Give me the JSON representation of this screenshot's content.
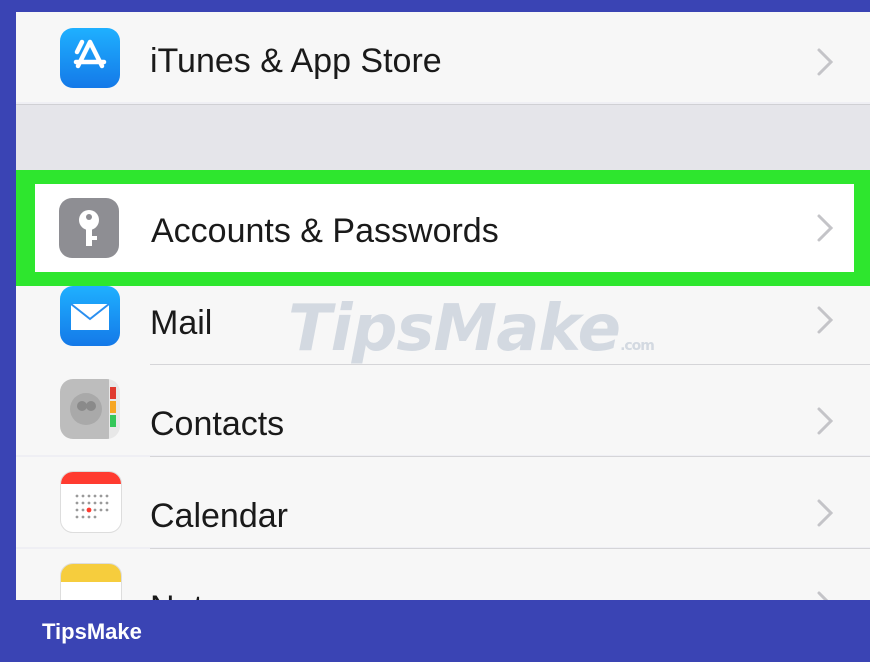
{
  "settings": {
    "rows": [
      {
        "label": "iTunes & App Store",
        "icon": "app-store-icon"
      },
      {
        "label": "Accounts & Passwords",
        "icon": "key-icon"
      },
      {
        "label": "Mail",
        "icon": "mail-icon"
      },
      {
        "label": "Contacts",
        "icon": "contacts-icon"
      },
      {
        "label": "Calendar",
        "icon": "calendar-icon"
      },
      {
        "label": "Notes",
        "icon": "notes-icon"
      }
    ]
  },
  "watermark": {
    "main": "TipsMake",
    "suffix": ".com"
  },
  "footer": {
    "brand": "TipsMake"
  },
  "colors": {
    "highlight": "#2ee62e",
    "frame": "#3a44b4"
  }
}
